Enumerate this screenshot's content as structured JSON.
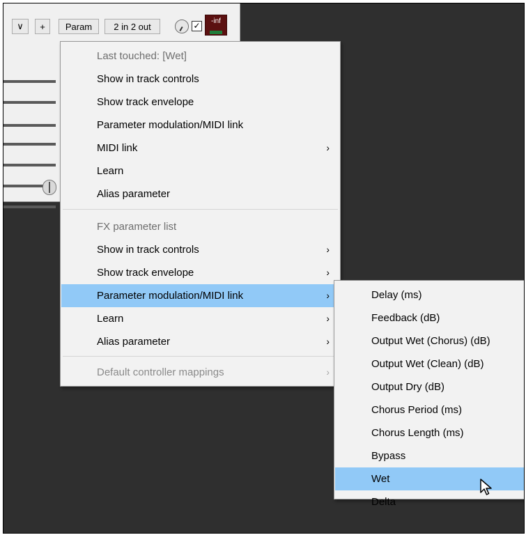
{
  "toolbar": {
    "dropdown_label": "∨",
    "add_label": "+",
    "param_label": "Param",
    "io_label": "2 in 2 out",
    "checkbox_mark": "✓",
    "meter_label": "-inf"
  },
  "context_menu": {
    "last_touched_header": "Last touched: [Wet]",
    "last_touched_items": [
      {
        "label": "Show in track controls"
      },
      {
        "label": "Show track envelope"
      },
      {
        "label": "Parameter modulation/MIDI link"
      },
      {
        "label": "MIDI link",
        "arrow": "›"
      },
      {
        "label": "Learn"
      },
      {
        "label": "Alias parameter"
      }
    ],
    "fx_list_header": "FX parameter list",
    "fx_list_items": [
      {
        "label": "Show in track controls",
        "arrow": "›"
      },
      {
        "label": "Show track envelope",
        "arrow": "›"
      },
      {
        "label": "Parameter modulation/MIDI link",
        "arrow": "›"
      },
      {
        "label": "Learn",
        "arrow": "›"
      },
      {
        "label": "Alias parameter",
        "arrow": "›"
      }
    ],
    "default_mappings": {
      "label": "Default controller mappings",
      "arrow": "›"
    }
  },
  "submenu": {
    "items": [
      "Delay (ms)",
      "Feedback (dB)",
      "Output Wet (Chorus) (dB)",
      "Output Wet (Clean) (dB)",
      "Output Dry (dB)",
      "Chorus Period (ms)",
      "Chorus Length (ms)",
      "Bypass",
      "Wet",
      "Delta"
    ]
  },
  "colors": {
    "highlight": "#91c9f7",
    "background_dark": "#2f2f2f",
    "menu_bg": "#f2f2f2"
  }
}
